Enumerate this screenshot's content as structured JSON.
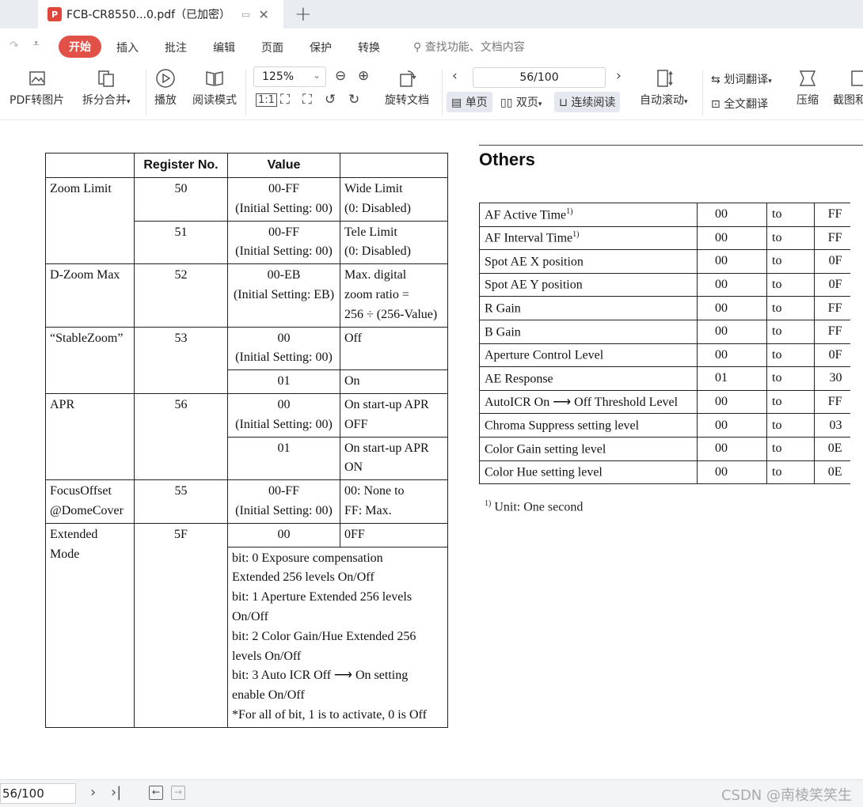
{
  "tab": {
    "badge": "P",
    "title": "FCB-CR8550...0.pdf（已加密）"
  },
  "menu": {
    "items": [
      "开始",
      "插入",
      "批注",
      "编辑",
      "页面",
      "保护",
      "转换"
    ],
    "search_placeholder": "查找功能、文档内容"
  },
  "ribbon": {
    "pdf_to_image": "PDF转图片",
    "split_merge": "拆分合并",
    "play": "播放",
    "read_mode": "阅读模式",
    "zoom": "125%",
    "rotate_doc": "旋转文档",
    "page_value": "56/100",
    "single_page": "单页",
    "double_page": "双页",
    "continuous": "连续阅读",
    "auto_scroll": "自动滚动",
    "word_translate": "划词翻译",
    "full_translate": "全文翻译",
    "compress": "压缩",
    "screenshot_compare": "截图和"
  },
  "table1": {
    "headers": [
      "",
      "Register No.",
      "Value",
      ""
    ],
    "zoom_limit": "Zoom Limit",
    "r50": "50",
    "v50a": "00-FF",
    "v50b": "(Initial Setting: 00)",
    "d50a": "Wide Limit",
    "d50b": "(0: Disabled)",
    "r51": "51",
    "v51a": "00-FF",
    "v51b": "(Initial Setting: 00)",
    "d51a": "Tele Limit",
    "d51b": "(0: Disabled)",
    "dzoom": "D-Zoom Max",
    "r52": "52",
    "v52a": "00-EB",
    "v52b": "(Initial Setting: EB)",
    "d52a": "Max. digital",
    "d52b": "zoom ratio =",
    "d52c": "256 ÷ (256-Value)",
    "stable": "“StableZoom”",
    "r53": "53",
    "v53a": "00",
    "v53b": "(Initial Setting: 00)",
    "d53a": "Off",
    "v53c": "01",
    "d53b": "On",
    "apr": "APR",
    "r56": "56",
    "v56a": "00",
    "v56b": "(Initial Setting: 00)",
    "d56a": "On start-up APR",
    "d56b": "OFF",
    "v56c": "01",
    "d56c": "On start-up APR",
    "d56d": "ON",
    "focus_a": "FocusOffset",
    "focus_b": "@DomeCover",
    "r55": "55",
    "v55a": "00-FF",
    "v55b": "(Initial Setting: 00)",
    "d55a": "00: None to",
    "d55b": "FF: Max.",
    "ext_a": "Extended",
    "ext_b": "Mode",
    "r5F": "5F",
    "v5F": "00",
    "d5F": "0FF",
    "bits": [
      "bit: 0  Exposure compensation",
      "Extended 256 levels On/Off",
      "bit: 1  Aperture Extended 256 levels",
      "On/Off",
      "bit: 2  Color Gain/Hue Extended 256",
      "levels On/Off",
      "bit: 3  Auto ICR Off ⟶ On setting",
      "enable On/Off",
      "*For all of bit, 1 is to activate, 0 is Off"
    ]
  },
  "others": {
    "title": "Others",
    "rows": [
      {
        "name": "AF Active Time",
        "sup": "1)",
        "from": "00",
        "to": "to",
        "upper": "FF"
      },
      {
        "name": "AF Interval Time",
        "sup": "1)",
        "from": "00",
        "to": "to",
        "upper": "FF"
      },
      {
        "name": "Spot AE X position",
        "sup": "",
        "from": "00",
        "to": "to",
        "upper": "0F"
      },
      {
        "name": "Spot AE Y position",
        "sup": "",
        "from": "00",
        "to": "to",
        "upper": "0F"
      },
      {
        "name": "R Gain",
        "sup": "",
        "from": "00",
        "to": "to",
        "upper": "FF"
      },
      {
        "name": "B Gain",
        "sup": "",
        "from": "00",
        "to": "to",
        "upper": "FF"
      },
      {
        "name": "Aperture Control Level",
        "sup": "",
        "from": "00",
        "to": "to",
        "upper": "0F"
      },
      {
        "name": "AE Response",
        "sup": "",
        "from": "01",
        "to": "to",
        "upper": "30"
      },
      {
        "name": "AutoICR On ⟶  Off Threshold Level",
        "sup": "",
        "from": "00",
        "to": "to",
        "upper": "FF"
      },
      {
        "name": "Chroma Suppress setting level",
        "sup": "",
        "from": "00",
        "to": "to",
        "upper": "03"
      },
      {
        "name": "Color Gain setting level",
        "sup": "",
        "from": "00",
        "to": "to",
        "upper": "0E"
      },
      {
        "name": "Color Hue setting level",
        "sup": "",
        "from": "00",
        "to": "to",
        "upper": "0E"
      }
    ],
    "footnote_sup": "1)",
    "footnote": " Unit: One second"
  },
  "status": {
    "page": "56/100",
    "watermark": "CSDN @南棱笑笑生"
  }
}
